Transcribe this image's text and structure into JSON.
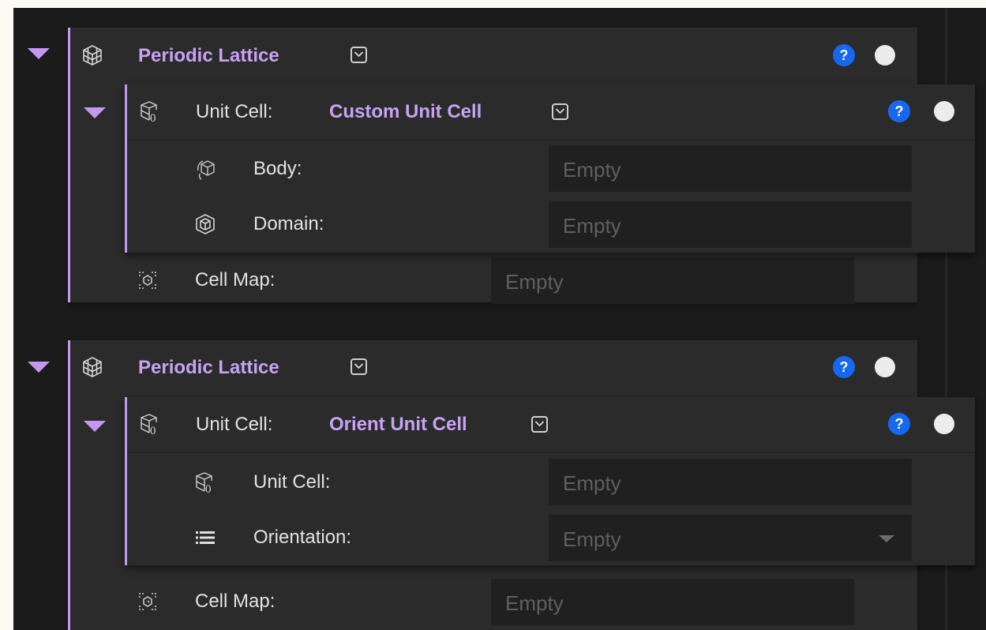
{
  "blocks": [
    {
      "lattice": {
        "title": "Periodic Lattice",
        "icon": "lattice-cube-icon",
        "help": "?"
      },
      "unit_cell": {
        "label": "Unit Cell:",
        "type": "Custom Unit Cell",
        "icon": "unit-cell-icon",
        "help": "?",
        "rows": [
          {
            "label": "Body:",
            "icon": "body-icon",
            "value": "Empty",
            "has_dropdown": false
          },
          {
            "label": "Domain:",
            "icon": "domain-box-icon",
            "value": "Empty",
            "has_dropdown": false
          }
        ]
      },
      "cell_map": {
        "label": "Cell Map:",
        "icon": "cell-map-icon",
        "value": "Empty"
      }
    },
    {
      "lattice": {
        "title": "Periodic Lattice",
        "icon": "lattice-cube-icon",
        "help": "?"
      },
      "unit_cell": {
        "label": "Unit Cell:",
        "type": "Orient Unit Cell",
        "icon": "unit-cell-icon",
        "help": "?",
        "rows": [
          {
            "label": "Unit Cell:",
            "icon": "unit-cell-icon",
            "value": "Empty",
            "has_dropdown": false
          },
          {
            "label": "Orientation:",
            "icon": "list-icon",
            "value": "Empty",
            "has_dropdown": true
          }
        ]
      },
      "cell_map": {
        "label": "Cell Map:",
        "icon": "cell-map-icon",
        "value": "Empty"
      }
    }
  ],
  "colors": {
    "accent": "#c497f0",
    "help": "#1668f0",
    "panel": "#2b2b2b",
    "field": "#202020",
    "background": "#1b1b1b"
  }
}
